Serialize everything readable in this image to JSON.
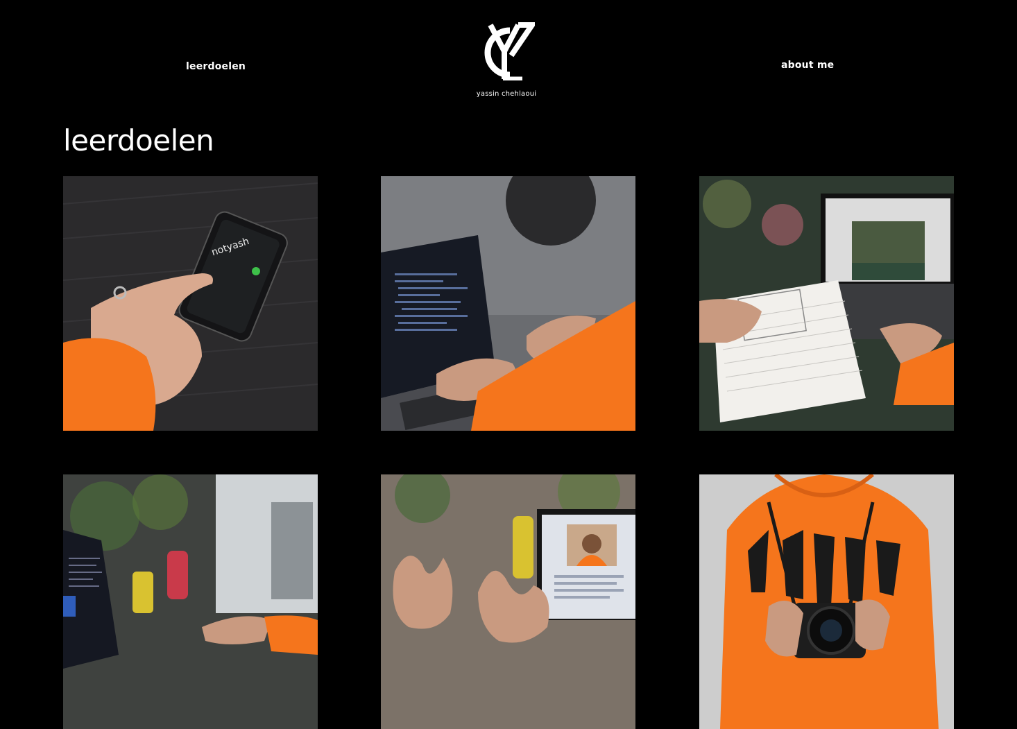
{
  "header": {
    "nav_left_label": "leerdoelen",
    "nav_right_label": "about me",
    "logo_name": "yassin chehlaoui"
  },
  "main": {
    "title": "leerdoelen",
    "photos": [
      {
        "subject": "hand-on-phone"
      },
      {
        "subject": "typing-on-laptop-code"
      },
      {
        "subject": "sketching-wireframe-next-to-laptop"
      },
      {
        "subject": "laptop-in-room-with-plants"
      },
      {
        "subject": "video-call-gesturing"
      },
      {
        "subject": "orange-hoodie-with-camera"
      }
    ]
  },
  "colors": {
    "background": "#000000",
    "text": "#ffffff",
    "accent_orange": "#f5751c"
  }
}
